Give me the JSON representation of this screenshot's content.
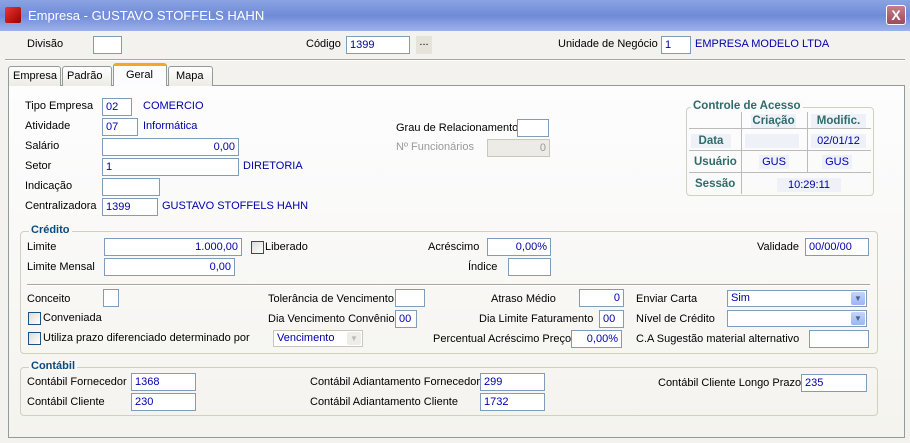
{
  "window": {
    "title": "Empresa - GUSTAVO STOFFELS HAHN",
    "close": "X"
  },
  "header": {
    "divisao_label": "Divisão",
    "divisao": "",
    "codigo_label": "Código",
    "codigo": "1399",
    "lookup": "...",
    "unidade_label": "Unidade de Negócio",
    "unidade": "1",
    "unidade_nome": "EMPRESA MODELO LTDA"
  },
  "tabs": [
    "Empresa",
    "Padrão",
    "Geral",
    "Mapa"
  ],
  "geral": {
    "tipo_label": "Tipo Empresa",
    "tipo": "02",
    "tipo_nome": "COMERCIO",
    "atividade_label": "Atividade",
    "atividade": "07",
    "atividade_nome": "Informática",
    "salario_label": "Salário",
    "salario": "0,00",
    "setor_label": "Setor",
    "setor": "1",
    "setor_nome": "DIRETORIA",
    "indicacao_label": "Indicação",
    "indicacao": "",
    "central_label": "Centralizadora",
    "central": "1399",
    "central_nome": "GUSTAVO STOFFELS HAHN",
    "grau_label": "Grau de Relacionamento",
    "grau": "",
    "func_label": "Nº Funcionários",
    "func": "0"
  },
  "acesso": {
    "title": "Controle de Acesso",
    "criacao": "Criação",
    "modific": "Modific.",
    "data_label": "Data",
    "data_criacao": "",
    "data_modific": "02/01/12",
    "usuario_label": "Usuário",
    "usuario_criacao": "GUS",
    "usuario_modific": "GUS",
    "sessao_label": "Sessão",
    "sessao": "10:29:11"
  },
  "credito": {
    "title": "Crédito",
    "limite_label": "Limite",
    "limite": "1.000,00",
    "liberado": "Liberado",
    "acrescimo_label": "Acréscimo",
    "acrescimo": "0,00%",
    "validade_label": "Validade",
    "validade": "00/00/00",
    "limite_mensal_label": "Limite Mensal",
    "limite_mensal": "0,00",
    "indice_label": "Índice",
    "indice": "",
    "conceito_label": "Conceito",
    "conceito": "",
    "tolerancia_label": "Tolerância de Vencimento",
    "tolerancia": "",
    "atraso_label": "Atraso Médio",
    "atraso": "0",
    "enviar_label": "Enviar Carta",
    "enviar": "Sim",
    "conveniada": "Conveniada",
    "dia_venc_label": "Dia Vencimento Convênio",
    "dia_venc": "00",
    "dia_lim_label": "Dia Limite Faturamento",
    "dia_lim": "00",
    "nivel_label": "Nível de Crédito",
    "nivel": "",
    "utiliza": "Utiliza prazo diferenciado determinado por",
    "prazo_por": "Vencimento",
    "percentual_label": "Percentual Acréscimo Preço",
    "percentual": "0,00%",
    "ca_label": "C.A Sugestão material alternativo",
    "ca": ""
  },
  "contabil": {
    "title": "Contábil",
    "fornecedor_label": "Contábil Fornecedor",
    "fornecedor": "1368",
    "cliente_label": "Contábil Cliente",
    "cliente": "230",
    "adiant_forn_label": "Contábil Adiantamento Fornecedor",
    "adiant_forn": "299",
    "adiant_cli_label": "Contábil Adiantamento Cliente",
    "adiant_cli": "1732",
    "longo_label": "Contábil Cliente Longo Prazo",
    "longo": "235"
  }
}
